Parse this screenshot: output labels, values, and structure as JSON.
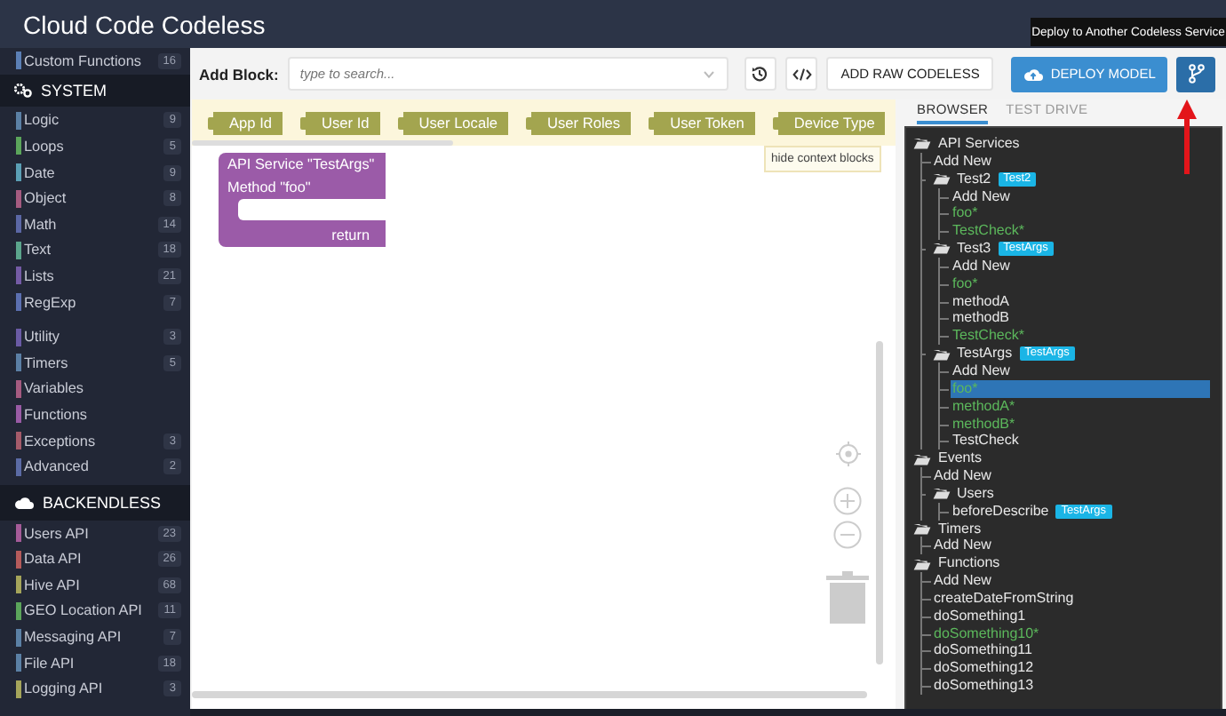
{
  "window": {
    "title": "Cloud Code Codeless"
  },
  "sidebar": {
    "top_items": [
      {
        "label": "Custom Functions",
        "count": "16",
        "color": "#5b7fb5"
      }
    ],
    "sections": [
      {
        "title": "SYSTEM",
        "kind": "gears",
        "groups": [
          [
            {
              "label": "Logic",
              "count": "9",
              "color": "#5b80a5"
            },
            {
              "label": "Loops",
              "count": "5",
              "color": "#5ba55b"
            },
            {
              "label": "Date",
              "count": "9",
              "color": "#5b9fb5"
            },
            {
              "label": "Object",
              "count": "8",
              "color": "#a55b80"
            },
            {
              "label": "Math",
              "count": "14",
              "color": "#5b67a5"
            },
            {
              "label": "Text",
              "count": "18",
              "color": "#5ba58c"
            },
            {
              "label": "Lists",
              "count": "21",
              "color": "#745ba5"
            },
            {
              "label": "RegExp",
              "count": "7",
              "color": "#5b6fb0"
            }
          ],
          [
            {
              "label": "Utility",
              "count": "3",
              "color": "#6a5ba5"
            },
            {
              "label": "Timers",
              "count": "5",
              "color": "#5b7fa5"
            },
            {
              "label": "Variables",
              "color": "#a55b80"
            },
            {
              "label": "Functions",
              "color": "#995ba5"
            },
            {
              "label": "Exceptions",
              "count": "3",
              "color": "#a55b6a"
            },
            {
              "label": "Advanced",
              "count": "2",
              "color": "#5b6ba5"
            }
          ]
        ]
      },
      {
        "title": "BACKENDLESS",
        "kind": "cloud",
        "groups": [
          [
            {
              "label": "Users API",
              "count": "23",
              "color": "#a55b99"
            },
            {
              "label": "Data API",
              "count": "26",
              "color": "#b55b5b"
            },
            {
              "label": "Hive API",
              "count": "68",
              "color": "#a5a55b"
            },
            {
              "label": "GEO Location API",
              "count": "11",
              "color": "#5ba55b"
            },
            {
              "label": "Messaging API",
              "count": "7",
              "color": "#5b80a5"
            },
            {
              "label": "File API",
              "count": "18",
              "color": "#5b80a5"
            },
            {
              "label": "Logging API",
              "count": "3",
              "color": "#a5a55b"
            }
          ]
        ]
      }
    ]
  },
  "toolbar": {
    "label": "Add Block:",
    "search": {
      "placeholder": "type to search..."
    },
    "raw_button": "ADD RAW CODELESS",
    "deploy_button": "DEPLOY MODEL",
    "tooltip": "Deploy to Another Codeless Service"
  },
  "context_blocks": [
    "App Id",
    "User Id",
    "User Locale",
    "User Roles",
    "User Token",
    "Device Type"
  ],
  "context_hint": "hide context blocks",
  "canvas_block": {
    "title": "API Service \"TestArgs\"",
    "method": "Method \"foo\"",
    "return_label": "return"
  },
  "tabs": [
    {
      "label": "BROWSER",
      "selected": true
    },
    {
      "label": "TEST DRIVE",
      "selected": false
    }
  ],
  "tree": [
    {
      "label": "API Services",
      "kind": "folder",
      "selected": false,
      "modified": false,
      "children": [
        {
          "label": "Add New",
          "kind": "item",
          "selected": false,
          "modified": false
        },
        {
          "label": "Test2",
          "kind": "folder",
          "badge": "Test2",
          "selected": false,
          "modified": false,
          "children": [
            {
              "label": "Add New",
              "kind": "item",
              "selected": false,
              "modified": false
            },
            {
              "label": "foo*",
              "kind": "item",
              "selected": false,
              "modified": true
            },
            {
              "label": "TestCheck*",
              "kind": "item",
              "selected": false,
              "modified": true
            }
          ]
        },
        {
          "label": "Test3",
          "kind": "folder",
          "badge": "TestArgs",
          "selected": false,
          "modified": false,
          "children": [
            {
              "label": "Add New",
              "kind": "item",
              "selected": false,
              "modified": false
            },
            {
              "label": "foo*",
              "kind": "item",
              "selected": false,
              "modified": true
            },
            {
              "label": "methodA",
              "kind": "item",
              "selected": false,
              "modified": false
            },
            {
              "label": "methodB",
              "kind": "item",
              "selected": false,
              "modified": false
            },
            {
              "label": "TestCheck*",
              "kind": "item",
              "selected": false,
              "modified": true
            }
          ]
        },
        {
          "label": "TestArgs",
          "kind": "folder",
          "badge": "TestArgs",
          "selected": false,
          "modified": false,
          "children": [
            {
              "label": "Add New",
              "kind": "item",
              "selected": false,
              "modified": false
            },
            {
              "label": "foo*",
              "kind": "item",
              "selected": true,
              "modified": true
            },
            {
              "label": "methodA*",
              "kind": "item",
              "selected": false,
              "modified": true
            },
            {
              "label": "methodB*",
              "kind": "item",
              "selected": false,
              "modified": true
            },
            {
              "label": "TestCheck",
              "kind": "item",
              "selected": false,
              "modified": false
            }
          ]
        }
      ]
    },
    {
      "label": "Events",
      "kind": "folder",
      "selected": false,
      "modified": false,
      "children": [
        {
          "label": "Add New",
          "kind": "item",
          "selected": false,
          "modified": false
        },
        {
          "label": "Users",
          "kind": "folder",
          "selected": false,
          "modified": false,
          "children": [
            {
              "label": "beforeDescribe",
              "kind": "item",
              "badge": "TestArgs",
              "selected": false,
              "modified": false
            }
          ]
        }
      ]
    },
    {
      "label": "Timers",
      "kind": "folder",
      "selected": false,
      "modified": false,
      "children": [
        {
          "label": "Add New",
          "kind": "item",
          "selected": false,
          "modified": false
        }
      ]
    },
    {
      "label": "Functions",
      "kind": "folder",
      "selected": false,
      "modified": false,
      "children": [
        {
          "label": "Add New",
          "kind": "item",
          "selected": false,
          "modified": false
        },
        {
          "label": "createDateFromString",
          "kind": "item",
          "selected": false,
          "modified": false
        },
        {
          "label": "doSomething1",
          "kind": "item",
          "selected": false,
          "modified": false
        },
        {
          "label": "doSomething10*",
          "kind": "item",
          "selected": false,
          "modified": true
        },
        {
          "label": "doSomething11",
          "kind": "item",
          "selected": false,
          "modified": false
        },
        {
          "label": "doSomething12",
          "kind": "item",
          "selected": false,
          "modified": false
        },
        {
          "label": "doSomething13",
          "kind": "item",
          "selected": false,
          "modified": false
        }
      ]
    }
  ]
}
